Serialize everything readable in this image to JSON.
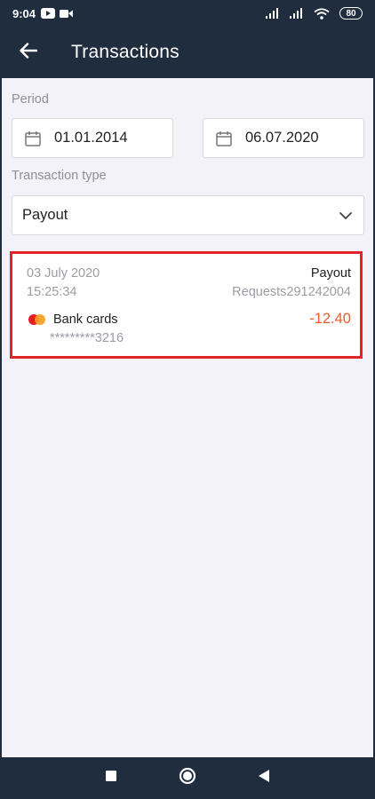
{
  "status_bar": {
    "time": "9:04",
    "battery": "80",
    "icons": [
      "youtube-icon",
      "video-camera-icon",
      "signal-icon",
      "signal-icon",
      "wifi-icon",
      "battery-icon"
    ]
  },
  "app_bar": {
    "title": "Transactions",
    "back_icon": "arrow-left-icon"
  },
  "filters": {
    "period_label": "Period",
    "date_from": "01.01.2014",
    "date_to": "06.07.2020",
    "separator": "–",
    "type_label": "Transaction type",
    "type_value": "Payout"
  },
  "transactions": [
    {
      "date": "03 July 2020",
      "time": "15:25:34",
      "type": "Payout",
      "request": "Requests291242004",
      "method": "Bank cards",
      "card_number": "*********3216",
      "amount": "-12.40"
    }
  ],
  "colors": {
    "header_bg": "#1f2d3e",
    "content_bg": "#f3f2f8",
    "highlight_border": "#e3232b",
    "amount_negative": "#f05a28"
  },
  "nav_bar": {
    "icons": [
      "square-recents-icon",
      "circle-home-icon",
      "triangle-back-icon"
    ]
  }
}
